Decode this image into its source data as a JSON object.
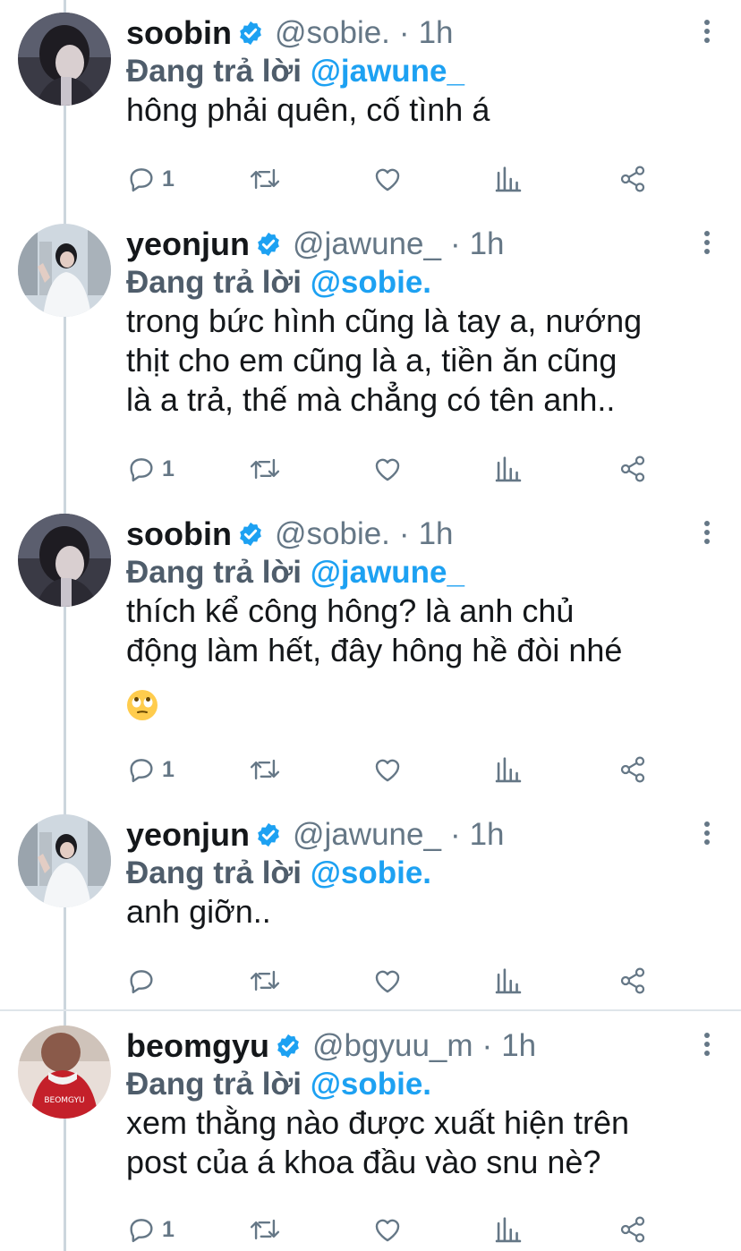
{
  "tweets": [
    {
      "name": "soobin",
      "handle": "@sobie.",
      "dot": "·",
      "time": "1h",
      "reply_prefix": "Đang trả lời ",
      "reply_to": "@jawune_",
      "text": "hông phải quên, cố tình á",
      "reply_count": "1",
      "avatar": "soobin-avatar"
    },
    {
      "name": "yeonjun",
      "handle": "@jawune_",
      "dot": "·",
      "time": "1h",
      "reply_prefix": "Đang trả lời ",
      "reply_to": "@sobie.",
      "text": "trong bức hình cũng là tay a, nướng\nthịt cho em cũng là a, tiền ăn cũng\nlà a trả, thế mà chẳng có tên anh..",
      "reply_count": "1",
      "avatar": "yeonjun-avatar"
    },
    {
      "name": "soobin",
      "handle": "@sobie.",
      "dot": "·",
      "time": "1h",
      "reply_prefix": "Đang trả lời ",
      "reply_to": "@jawune_",
      "text": "thích kể công hông? là anh chủ\nđộng làm hết, đây hông hề đòi nhé",
      "emoji": "face-with-rolling-eyes",
      "reply_count": "1",
      "avatar": "soobin-avatar"
    },
    {
      "name": "yeonjun",
      "handle": "@jawune_",
      "dot": "·",
      "time": "1h",
      "reply_prefix": "Đang trả lời ",
      "reply_to": "@sobie.",
      "text": "anh giỡn..",
      "reply_count": "",
      "avatar": "yeonjun-avatar"
    },
    {
      "name": "beomgyu",
      "handle": "@bgyuu_m",
      "dot": "·",
      "time": "1h",
      "reply_prefix": "Đang trả lời ",
      "reply_to": "@sobie.",
      "text": "xem thằng nào được xuất hiện trên\npost của á khoa đầu vào snu nè?",
      "reply_count": "1",
      "avatar": "beomgyu-avatar",
      "jersey_text": "BEOMGYU"
    }
  ],
  "colors": {
    "accent": "#1da1f2",
    "muted": "#657786",
    "text": "#14171a",
    "thread_line": "#ccd6dd"
  },
  "icons": [
    "reply-icon",
    "retweet-icon",
    "like-icon",
    "stats-icon",
    "share-icon",
    "verified-icon",
    "more-icon"
  ]
}
